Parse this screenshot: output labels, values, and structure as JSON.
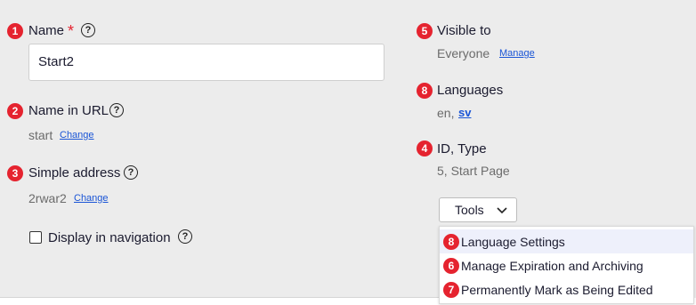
{
  "left_column": {
    "name": {
      "badge": "1",
      "label": "Name",
      "required_mark": "*",
      "help": "?",
      "value": "Start2"
    },
    "name_in_url": {
      "badge": "2",
      "label": "Name in URL",
      "help": "?",
      "value": "start",
      "link": "Change"
    },
    "simple_address": {
      "badge": "3",
      "label": "Simple address",
      "help": "?",
      "value": "2rwar2",
      "link": "Change"
    },
    "display_in_navigation": {
      "label": "Display in navigation",
      "help": "?",
      "checked": false
    }
  },
  "right_column": {
    "visible_to": {
      "badge": "5",
      "label": "Visible to",
      "value": "Everyone",
      "link": "Manage"
    },
    "languages": {
      "badge": "8",
      "label": "Languages",
      "value_prefix": "en, ",
      "link": "sv"
    },
    "id_type": {
      "badge": "4",
      "label": "ID, Type",
      "value": "5, Start Page"
    }
  },
  "tools": {
    "label": "Tools",
    "icon": "chevron-down-icon",
    "menu": [
      {
        "badge": "8",
        "label": "Language Settings"
      },
      {
        "badge": "6",
        "label": "Manage Expiration and Archiving"
      },
      {
        "badge": "7",
        "label": "Permanently Mark as Being Edited"
      }
    ]
  },
  "colors": {
    "badge": "#e5232f",
    "link": "#1a55d6",
    "panel": "#ececec"
  }
}
